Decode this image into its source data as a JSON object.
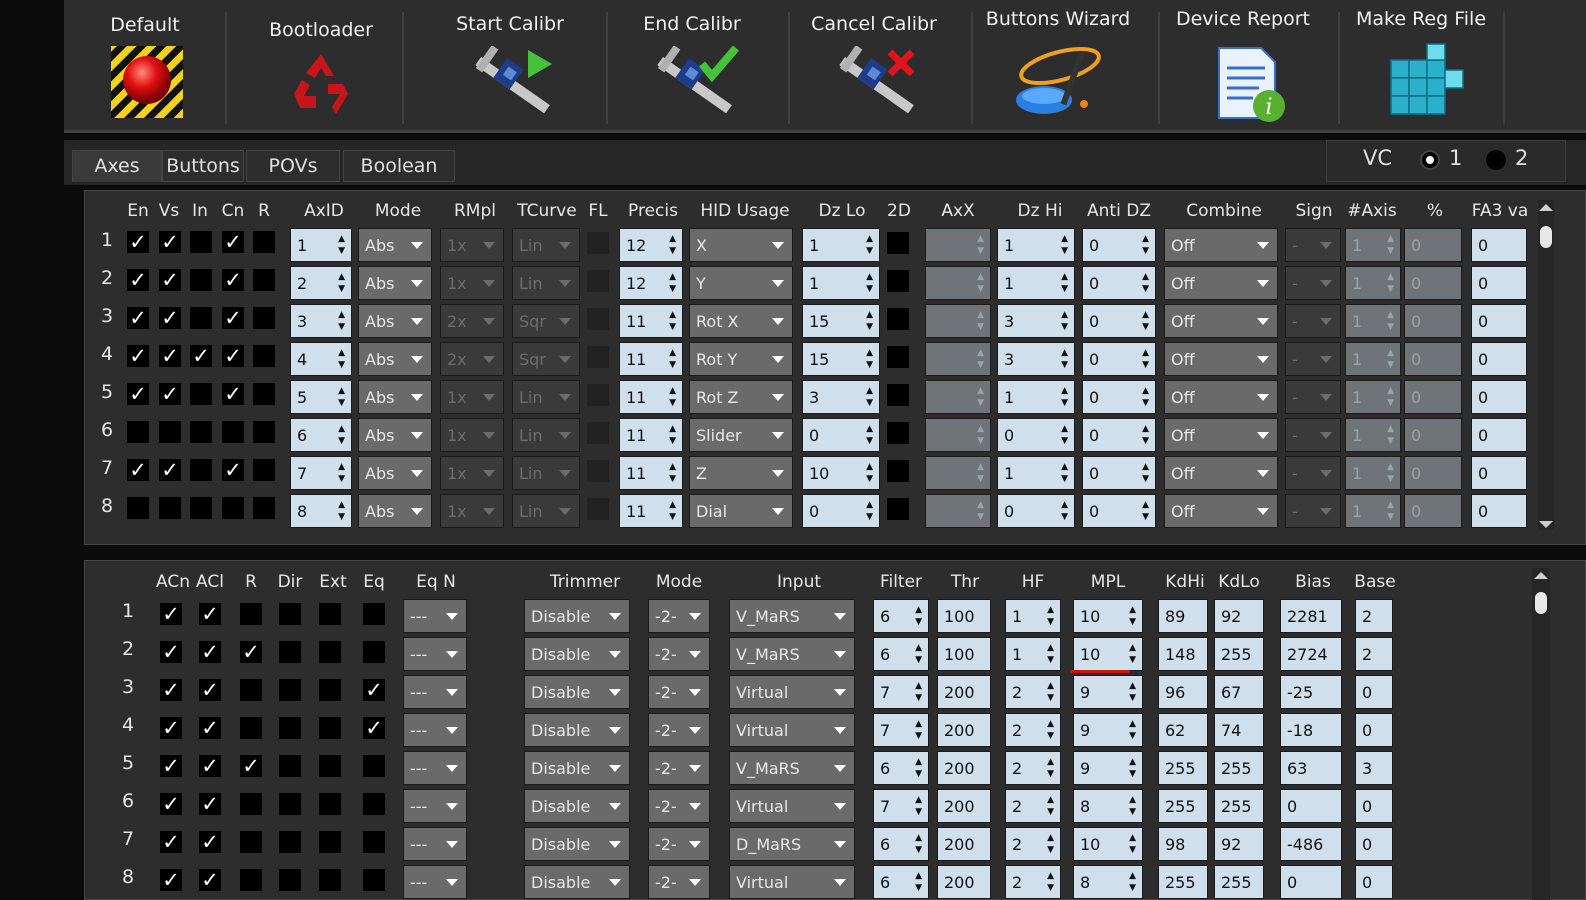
{
  "toolbar": {
    "items": [
      {
        "label": "Default",
        "icon": "red-button-icon"
      },
      {
        "label": "Bootloader",
        "icon": "recycle-icon"
      },
      {
        "label": "Start Calibr",
        "icon": "caliper-play-icon"
      },
      {
        "label": "End Calibr",
        "icon": "caliper-check-icon"
      },
      {
        "label": "Cancel Calibr",
        "icon": "caliper-cancel-icon"
      },
      {
        "label": "Buttons Wizard",
        "icon": "wizard-icon"
      },
      {
        "label": "Device Report",
        "icon": "report-icon"
      },
      {
        "label": "Make Reg File",
        "icon": "registry-cube-icon"
      }
    ]
  },
  "tabs": [
    "Axes",
    "Buttons",
    "POVs",
    "Boolean"
  ],
  "active_tab": "Axes",
  "vc": {
    "label": "VC",
    "opt1": "1",
    "opt2": "2",
    "selected": "1"
  },
  "axes": {
    "headers": {
      "en": "En",
      "vs": "Vs",
      "in": "In",
      "cn": "Cn",
      "r": "R",
      "axid": "AxID",
      "mode": "Mode",
      "rmpl": "RMpl",
      "tcurve": "TCurve",
      "fl": "FL",
      "precis": "Precis",
      "hid": "HID Usage",
      "dzlo": "Dz Lo",
      "twod": "2D",
      "axx": "AxX",
      "dzhi": "Dz Hi",
      "antidz": "Anti DZ",
      "combine": "Combine",
      "sign": "Sign",
      "naxis": "#Axis",
      "pct": "%",
      "fa3": "FA3 va"
    },
    "rows": [
      {
        "n": "1",
        "en": true,
        "vs": true,
        "in": false,
        "cn": true,
        "r": false,
        "axid": "1",
        "mode": "Abs",
        "rmpl": "1x",
        "tcurve": "Lin",
        "precis": "12",
        "hid": "X",
        "dzlo": "1",
        "dzhi": "1",
        "antidz": "0",
        "combine": "Off",
        "sign": "-",
        "naxis": "1",
        "pct": "0",
        "fa3": "0"
      },
      {
        "n": "2",
        "en": true,
        "vs": true,
        "in": false,
        "cn": true,
        "r": false,
        "axid": "2",
        "mode": "Abs",
        "rmpl": "1x",
        "tcurve": "Lin",
        "precis": "12",
        "hid": "Y",
        "dzlo": "1",
        "dzhi": "1",
        "antidz": "0",
        "combine": "Off",
        "sign": "-",
        "naxis": "1",
        "pct": "0",
        "fa3": "0"
      },
      {
        "n": "3",
        "en": true,
        "vs": true,
        "in": false,
        "cn": true,
        "r": false,
        "axid": "3",
        "mode": "Abs",
        "rmpl": "2x",
        "tcurve": "Sqr",
        "precis": "11",
        "hid": "Rot X",
        "dzlo": "15",
        "dzhi": "3",
        "antidz": "0",
        "combine": "Off",
        "sign": "-",
        "naxis": "1",
        "pct": "0",
        "fa3": "0"
      },
      {
        "n": "4",
        "en": true,
        "vs": true,
        "in": true,
        "cn": true,
        "r": false,
        "axid": "4",
        "mode": "Abs",
        "rmpl": "2x",
        "tcurve": "Sqr",
        "precis": "11",
        "hid": "Rot Y",
        "dzlo": "15",
        "dzhi": "3",
        "antidz": "0",
        "combine": "Off",
        "sign": "-",
        "naxis": "1",
        "pct": "0",
        "fa3": "0"
      },
      {
        "n": "5",
        "en": true,
        "vs": true,
        "in": false,
        "cn": true,
        "r": false,
        "axid": "5",
        "mode": "Abs",
        "rmpl": "1x",
        "tcurve": "Lin",
        "precis": "11",
        "hid": "Rot Z",
        "dzlo": "3",
        "dzhi": "1",
        "antidz": "0",
        "combine": "Off",
        "sign": "-",
        "naxis": "1",
        "pct": "0",
        "fa3": "0"
      },
      {
        "n": "6",
        "en": false,
        "vs": false,
        "in": false,
        "cn": false,
        "r": false,
        "axid": "6",
        "mode": "Abs",
        "rmpl": "1x",
        "tcurve": "Lin",
        "precis": "11",
        "hid": "Slider",
        "dzlo": "0",
        "dzhi": "0",
        "antidz": "0",
        "combine": "Off",
        "sign": "-",
        "naxis": "1",
        "pct": "0",
        "fa3": "0"
      },
      {
        "n": "7",
        "en": true,
        "vs": true,
        "in": false,
        "cn": true,
        "r": false,
        "axid": "7",
        "mode": "Abs",
        "rmpl": "1x",
        "tcurve": "Lin",
        "precis": "11",
        "hid": "Z",
        "dzlo": "10",
        "dzhi": "1",
        "antidz": "0",
        "combine": "Off",
        "sign": "-",
        "naxis": "1",
        "pct": "0",
        "fa3": "0"
      },
      {
        "n": "8",
        "en": false,
        "vs": false,
        "in": false,
        "cn": false,
        "r": false,
        "axid": "8",
        "mode": "Abs",
        "rmpl": "1x",
        "tcurve": "Lin",
        "precis": "11",
        "hid": "Dial",
        "dzlo": "0",
        "dzhi": "0",
        "antidz": "0",
        "combine": "Off",
        "sign": "-",
        "naxis": "1",
        "pct": "0",
        "fa3": "0"
      }
    ]
  },
  "src": {
    "headers": {
      "acn": "ACn",
      "acl": "ACl",
      "r": "R",
      "dir": "Dir",
      "ext": "Ext",
      "eq": "Eq",
      "eqn": "Eq N",
      "trimmer": "Trimmer",
      "mode": "Mode",
      "input": "Input",
      "filter": "Filter",
      "thr": "Thr",
      "hf": "HF",
      "mpl": "MPL",
      "kdhi": "KdHi",
      "kdlo": "KdLo",
      "bias": "Bias",
      "base": "Base"
    },
    "rows": [
      {
        "n": "1",
        "acn": true,
        "acl": true,
        "r": false,
        "dir": false,
        "ext": false,
        "eq": false,
        "eqn": "---",
        "trimmer": "Disable",
        "mode": "-2-",
        "input": "V_MaRS",
        "filter": "6",
        "thr": "100",
        "hf": "1",
        "mpl": "10",
        "kdhi": "89",
        "kdlo": "92",
        "bias": "2281",
        "base": "2"
      },
      {
        "n": "2",
        "acn": true,
        "acl": true,
        "r": true,
        "dir": false,
        "ext": false,
        "eq": false,
        "eqn": "---",
        "trimmer": "Disable",
        "mode": "-2-",
        "input": "V_MaRS",
        "filter": "6",
        "thr": "100",
        "hf": "1",
        "mpl": "10",
        "kdhi": "148",
        "kdlo": "255",
        "bias": "2724",
        "base": "2"
      },
      {
        "n": "3",
        "acn": true,
        "acl": true,
        "r": false,
        "dir": false,
        "ext": false,
        "eq": true,
        "eqn": "---",
        "trimmer": "Disable",
        "mode": "-2-",
        "input": "Virtual",
        "filter": "7",
        "thr": "200",
        "hf": "2",
        "mpl": "9",
        "kdhi": "96",
        "kdlo": "67",
        "bias": "-25",
        "base": "0"
      },
      {
        "n": "4",
        "acn": true,
        "acl": true,
        "r": false,
        "dir": false,
        "ext": false,
        "eq": true,
        "eqn": "---",
        "trimmer": "Disable",
        "mode": "-2-",
        "input": "Virtual",
        "filter": "7",
        "thr": "200",
        "hf": "2",
        "mpl": "9",
        "kdhi": "62",
        "kdlo": "74",
        "bias": "-18",
        "base": "0"
      },
      {
        "n": "5",
        "acn": true,
        "acl": true,
        "r": true,
        "dir": false,
        "ext": false,
        "eq": false,
        "eqn": "---",
        "trimmer": "Disable",
        "mode": "-2-",
        "input": "V_MaRS",
        "filter": "6",
        "thr": "200",
        "hf": "2",
        "mpl": "9",
        "kdhi": "255",
        "kdlo": "255",
        "bias": "63",
        "base": "3"
      },
      {
        "n": "6",
        "acn": true,
        "acl": true,
        "r": false,
        "dir": false,
        "ext": false,
        "eq": false,
        "eqn": "---",
        "trimmer": "Disable",
        "mode": "-2-",
        "input": "Virtual",
        "filter": "7",
        "thr": "200",
        "hf": "2",
        "mpl": "8",
        "kdhi": "255",
        "kdlo": "255",
        "bias": "0",
        "base": "0"
      },
      {
        "n": "7",
        "acn": true,
        "acl": true,
        "r": false,
        "dir": false,
        "ext": false,
        "eq": false,
        "eqn": "---",
        "trimmer": "Disable",
        "mode": "-2-",
        "input": "D_MaRS",
        "filter": "6",
        "thr": "200",
        "hf": "2",
        "mpl": "10",
        "kdhi": "98",
        "kdlo": "92",
        "bias": "-486",
        "base": "0"
      },
      {
        "n": "8",
        "acn": true,
        "acl": true,
        "r": false,
        "dir": false,
        "ext": false,
        "eq": false,
        "eqn": "---",
        "trimmer": "Disable",
        "mode": "-2-",
        "input": "Virtual",
        "filter": "6",
        "thr": "200",
        "hf": "2",
        "mpl": "8",
        "kdhi": "255",
        "kdlo": "255",
        "bias": "0",
        "base": "0"
      }
    ]
  },
  "colors": {
    "background": "#2d2d2d",
    "field": "#cfe0ec",
    "combo": "#6a6a6a",
    "disabled": "#6f7478",
    "highlight": "#d01010"
  }
}
